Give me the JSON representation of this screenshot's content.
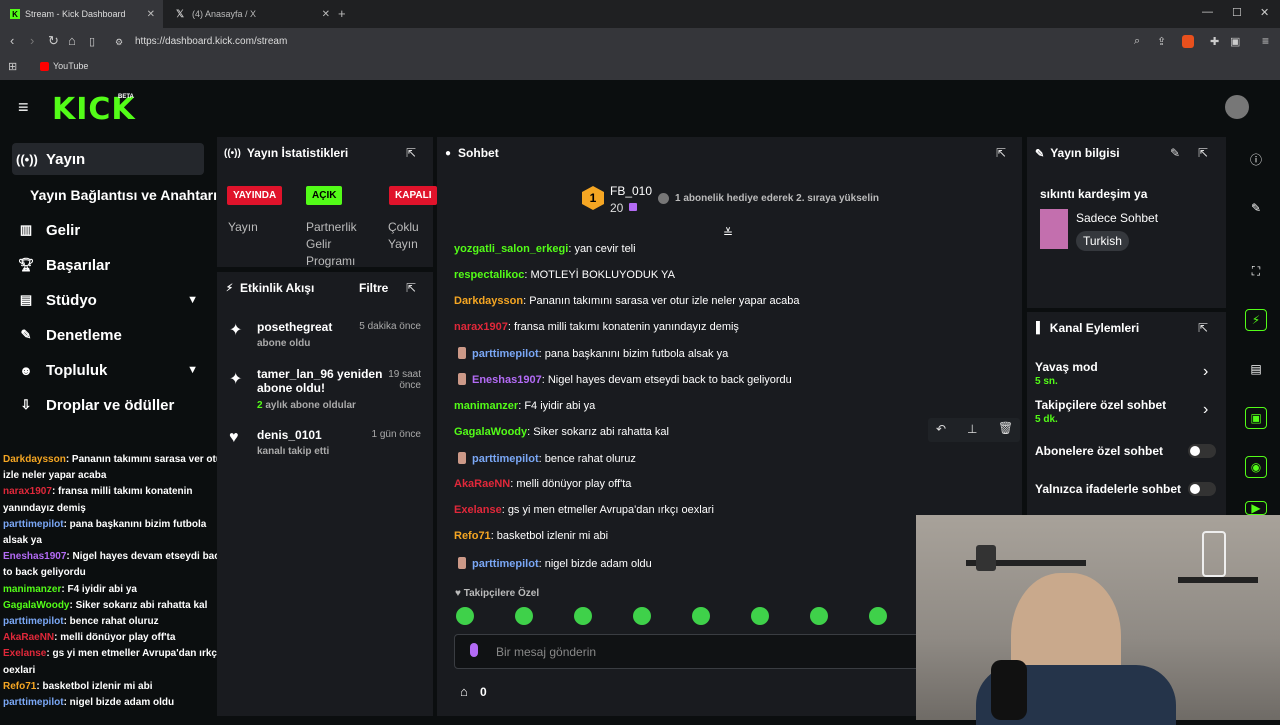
{
  "browser": {
    "tabs": [
      {
        "label": "Stream - Kick Dashboard"
      },
      {
        "label": "(4) Anasayfa / X"
      }
    ],
    "url": "https://dashboard.kick.com/stream",
    "bookmark": "YouTube"
  },
  "brand": {
    "logo": "KICK",
    "beta": "BETA",
    "accent": "#53fc18"
  },
  "sidebar": {
    "items": [
      {
        "label": "Yayın",
        "icon": "broadcast-icon"
      },
      {
        "label": "Yayın Bağlantısı ve Anahtarı",
        "icon": ""
      },
      {
        "label": "Gelir",
        "icon": "chart-icon"
      },
      {
        "label": "Başarılar",
        "icon": "trophy-icon"
      },
      {
        "label": "Stüdyo",
        "icon": "grid-icon"
      },
      {
        "label": "Denetleme",
        "icon": "wrench-icon"
      },
      {
        "label": "Topluluk",
        "icon": "people-icon"
      },
      {
        "label": "Droplar ve ödüller",
        "icon": "drops-icon"
      }
    ]
  },
  "overlay_chat": [
    {
      "user": "Darkdaysson",
      "text": ": Pananın takımını sarasa ver otur izle neler yapar acaba",
      "color": "#f5a623"
    },
    {
      "user": "narax1907",
      "text": ": fransa milli takımı konatenin yanındayız demiş",
      "color": "#e0283a"
    },
    {
      "user": "parttimepilot",
      "text": ": pana başkanını bizim futbola alsak ya",
      "color": "#7aa7f5"
    },
    {
      "user": "Eneshas1907",
      "text": ": Nigel hayes devam etseydi back to back geliyordu",
      "color": "#b36bf5"
    },
    {
      "user": "manimanzer",
      "text": ": F4 iyidir abi ya",
      "color": "#53fc18"
    },
    {
      "user": "GagalaWoody",
      "text": ": Siker sokarız abi rahatta kal",
      "color": "#53fc18"
    },
    {
      "user": "parttimepilot",
      "text": ": bence rahat oluruz",
      "color": "#7aa7f5"
    },
    {
      "user": "AkaRaeNN",
      "text": ": melli dönüyor play off'ta",
      "color": "#e0283a"
    },
    {
      "user": "Exelanse",
      "text": ": gs yi men etmeller Avrupa'dan ırkçı oexlari",
      "color": "#e0283a"
    },
    {
      "user": "Refo71",
      "text": ": basketbol izlenir mi abi",
      "color": "#f5a623"
    },
    {
      "user": "parttimepilot",
      "text": ": nigel bizde adam oldu",
      "color": "#7aa7f5"
    }
  ],
  "stats": {
    "title": "Yayın İstatistikleri",
    "badges": [
      {
        "badge": "YAYINDA",
        "label": "Yayın",
        "color": "#e0132b",
        "text_color": "#ffffff"
      },
      {
        "badge": "AÇIK",
        "label": "Partnerlik Gelir Programı",
        "color": "#53fc18",
        "text_color": "#000000"
      },
      {
        "badge": "KAPALI",
        "label": "Çoklu Yayın",
        "color": "#e0132b",
        "text_color": "#ffffff"
      }
    ]
  },
  "activity": {
    "title": "Etkinlik Akışı",
    "filter": "Filtre",
    "events": [
      {
        "title": "posethegreat",
        "sub": "abone oldu",
        "time": "5 dakika önce",
        "icon": "sparkle-icon"
      },
      {
        "title": "tamer_lan_96 yeniden abone oldu!",
        "sub": "2 aylık abone oldular",
        "time": "19 saat önce",
        "icon": "sparkle-icon"
      },
      {
        "title": "denis_0101",
        "sub": "kanalı takip etti",
        "time": "1 gün önce",
        "icon": "heart-icon"
      }
    ]
  },
  "chat": {
    "title": "Sohbet",
    "leader": {
      "rank": "1",
      "name": "FB_010",
      "count": "20",
      "note": "1 abonelik hediye ederek 2. sıraya yükselin"
    },
    "messages": [
      {
        "user": "yozgatli_salon_erkegi",
        "text": ": yan cevir teli",
        "color": "#53fc18",
        "badge": false
      },
      {
        "user": "respectalikoc",
        "text": ": MOTLEYİ BOKLUYODUK YA",
        "color": "#53fc18",
        "badge": false
      },
      {
        "user": "Darkdaysson",
        "text": ": Pananın takımını sarasa ver otur izle neler yapar acaba",
        "color": "#f5a623",
        "badge": false
      },
      {
        "user": "narax1907",
        "text": ": fransa milli takımı konatenin yanındayız demiş",
        "color": "#e0283a",
        "badge": false
      },
      {
        "user": "parttimepilot",
        "text": ": pana başkanını bizim futbola alsak ya",
        "color": "#7aa7f5",
        "badge": true
      },
      {
        "user": "Eneshas1907",
        "text": ": Nigel hayes devam etseydi back to back geliyordu",
        "color": "#b36bf5",
        "badge": true
      },
      {
        "user": "manimanzer",
        "text": ": F4 iyidir abi ya",
        "color": "#53fc18",
        "badge": false
      },
      {
        "user": "GagalaWoody",
        "text": ": Siker sokarız abi rahatta kal",
        "color": "#53fc18",
        "badge": false
      },
      {
        "user": "parttimepilot",
        "text": ": bence rahat oluruz",
        "color": "#7aa7f5",
        "badge": true
      },
      {
        "user": "AkaRaeNN",
        "text": ": melli dönüyor play off'ta",
        "color": "#e0283a",
        "badge": false
      },
      {
        "user": "Exelanse",
        "text": ": gs yi men etmeller Avrupa'dan ırkçı oexlari",
        "color": "#e0283a",
        "badge": false
      },
      {
        "user": "Refo71",
        "text": ": basketbol izlenir mi abi",
        "color": "#f5a623",
        "badge": false
      },
      {
        "user": "parttimepilot",
        "text": ": nigel bizde adam oldu",
        "color": "#7aa7f5",
        "badge": true
      }
    ],
    "followers_only": "Takipçilere Özel",
    "placeholder": "Bir mesaj gönderin",
    "points": "0"
  },
  "stream_info": {
    "title": "Yayın bilgisi",
    "stream_title": "sıkıntı kardeşim ya",
    "category": "Sadece Sohbet",
    "language": "Turkish"
  },
  "channel_actions": {
    "title": "Kanal Eylemleri",
    "items": [
      {
        "label": "Yavaş mod",
        "value": "5 sn.",
        "control": "chevron"
      },
      {
        "label": "Takipçilere özel sohbet",
        "value": "5 dk.",
        "control": "chevron"
      },
      {
        "label": "Abonelere özel sohbet",
        "value": "",
        "control": "toggle-off"
      },
      {
        "label": "Yalnızca ifadelerle sohbet",
        "value": "",
        "control": "toggle-off"
      }
    ]
  }
}
